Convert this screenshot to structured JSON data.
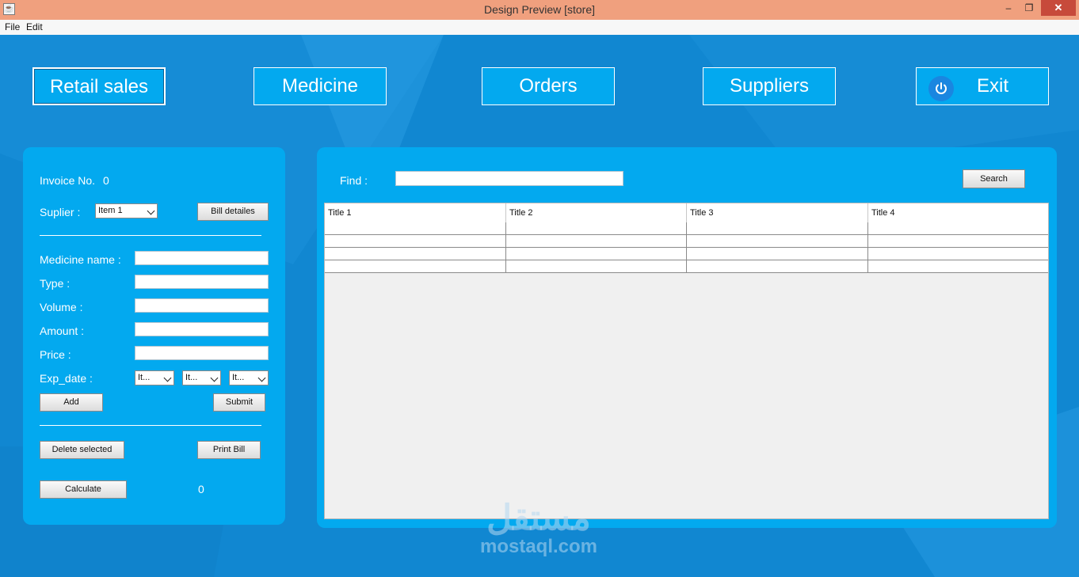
{
  "window": {
    "title": "Design Preview [store]",
    "app_icon": "java-icon",
    "controls": {
      "minimize": "–",
      "maximize": "❐",
      "close": "✕"
    }
  },
  "menu": {
    "items": [
      "File",
      "Edit"
    ]
  },
  "nav": {
    "buttons": [
      "Retail sales",
      "Medicine",
      "Orders",
      "Suppliers",
      "Exit"
    ],
    "active": "Retail sales",
    "exit_icon": "power-icon"
  },
  "left_panel": {
    "invoice_label": "Invoice No.",
    "invoice_value": "0",
    "supplier_label": "Suplier :",
    "supplier_selected": "Item 1",
    "bill_details_button": "Bill detailes",
    "medicine_name_label": "Medicine name :",
    "type_label": "Type :",
    "volume_label": "Volume :",
    "amount_label": "Amount :",
    "price_label": "Price :",
    "exp_date_label": "Exp_date :",
    "exp_date_selects": [
      "It...",
      "It...",
      "It..."
    ],
    "add_button": "Add",
    "submit_button": "Submit",
    "delete_button": "Delete selected",
    "print_button": "Print Bill",
    "calculate_button": "Calculate",
    "calculate_value": "0"
  },
  "right_panel": {
    "find_label": "Find :",
    "find_value": "",
    "search_button": "Search",
    "table": {
      "columns": [
        "Title 1",
        "Title 2",
        "Title 3",
        "Title 4"
      ],
      "rows": [
        [
          "",
          "",
          "",
          ""
        ],
        [
          "",
          "",
          "",
          ""
        ],
        [
          "",
          "",
          "",
          ""
        ],
        [
          "",
          "",
          "",
          ""
        ]
      ]
    }
  },
  "watermark": {
    "arabic": "مستقل",
    "latin": "mostaql.com"
  },
  "colors": {
    "background": "#1187d1",
    "panel": "#03a9ef",
    "titlebar": "#f0a07e",
    "close": "#c74a3b"
  }
}
